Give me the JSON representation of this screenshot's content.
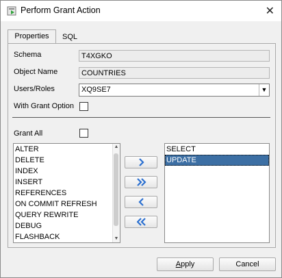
{
  "window": {
    "title": "Perform Grant Action",
    "close_glyph": "✕"
  },
  "tabs": [
    {
      "label": "Properties",
      "active": true
    },
    {
      "label": "SQL",
      "active": false
    }
  ],
  "form": {
    "schema_label": "Schema",
    "schema_value": "T4XGKO",
    "object_name_label": "Object Name",
    "object_name_value": "COUNTRIES",
    "users_roles_label": "Users/Roles",
    "users_roles_value": "XQ9SE7",
    "with_grant_option_label": "With Grant Option",
    "with_grant_option_checked": false,
    "grant_all_label": "Grant All",
    "grant_all_checked": false
  },
  "available_privileges": [
    "ALTER",
    "DELETE",
    "INDEX",
    "INSERT",
    "REFERENCES",
    "ON COMMIT REFRESH",
    "QUERY REWRITE",
    "DEBUG",
    "FLASHBACK"
  ],
  "selected_privileges": [
    {
      "label": "SELECT",
      "highlighted": false
    },
    {
      "label": "UPDATE",
      "highlighted": true
    }
  ],
  "move_buttons": [
    "move-right-icon",
    "move-all-right-icon",
    "move-left-icon",
    "move-all-left-icon"
  ],
  "buttons": {
    "apply_first": "A",
    "apply_rest": "pply",
    "cancel": "Cancel"
  },
  "colors": {
    "selection": "#3c6fa4",
    "arrow": "#2a6fd0"
  }
}
